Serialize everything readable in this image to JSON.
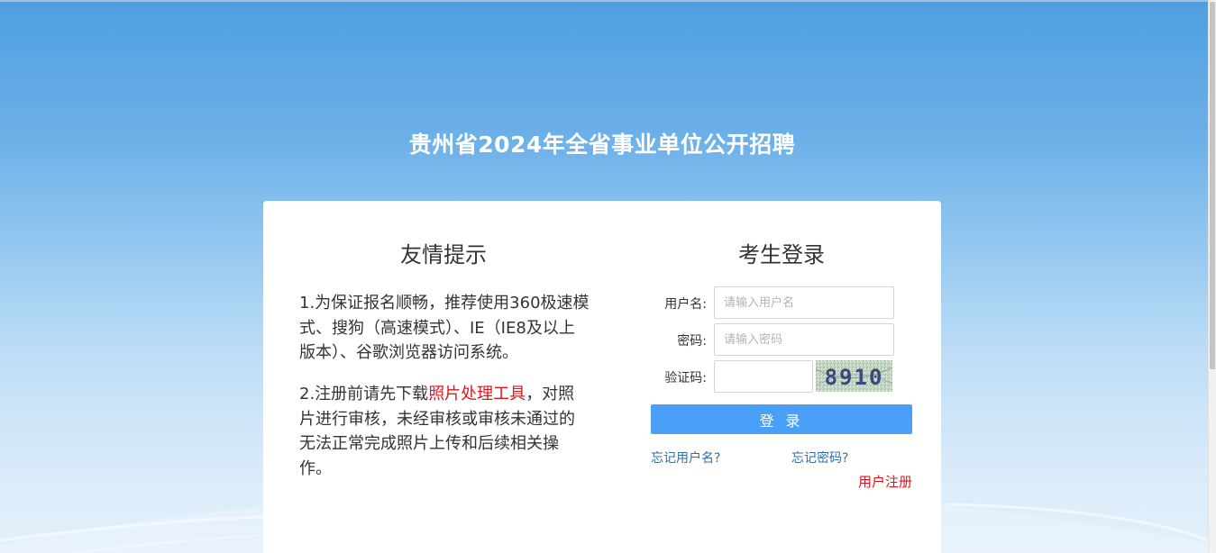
{
  "page": {
    "title": "贵州省2024年全省事业单位公开招聘"
  },
  "tips": {
    "title": "友情提示",
    "item1": "1.为保证报名顺畅，推荐使用360极速模式、搜狗（高速模式）、IE（IE8及以上版本）、谷歌浏览器访问系统。",
    "item2_prefix": "2.注册前请先下载",
    "item2_link": "照片处理工具",
    "item2_suffix": "，对照片进行审核，未经审核或审核未通过的无法正常完成照片上传和后续相关操作。"
  },
  "login": {
    "title": "考生登录",
    "username_label": "用户名:",
    "username_placeholder": "请输入用户名",
    "password_label": "密码:",
    "password_placeholder": "请输入密码",
    "captcha_label": "验证码:",
    "captcha_text": "8910",
    "login_button": "登 录",
    "forgot_username": "忘记用户名?",
    "forgot_password": "忘记密码?",
    "register": "用户注册"
  },
  "colors": {
    "primary_button": "#4aa0f8",
    "link_blue": "#2f6fa8",
    "link_red": "#e0141c"
  }
}
